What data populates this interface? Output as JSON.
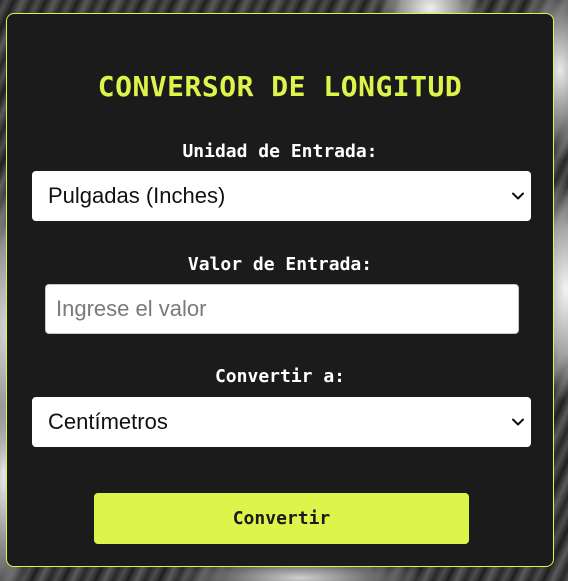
{
  "colors": {
    "accent": "#ddf54a",
    "card_background": "#1b1b1b",
    "label_text": "#ffffff",
    "field_background": "#ffffff"
  },
  "converter": {
    "title": "CONVERSOR DE LONGITUD",
    "input_unit": {
      "label": "Unidad de Entrada:",
      "selected": "Pulgadas (Inches)"
    },
    "input_value": {
      "label": "Valor de Entrada:",
      "placeholder": "Ingrese el valor",
      "value": ""
    },
    "output_unit": {
      "label": "Convertir a:",
      "selected": "Centímetros"
    },
    "convert_button": {
      "label": "Convertir"
    }
  },
  "icons": {
    "dropdown": "chevron-down-icon"
  }
}
